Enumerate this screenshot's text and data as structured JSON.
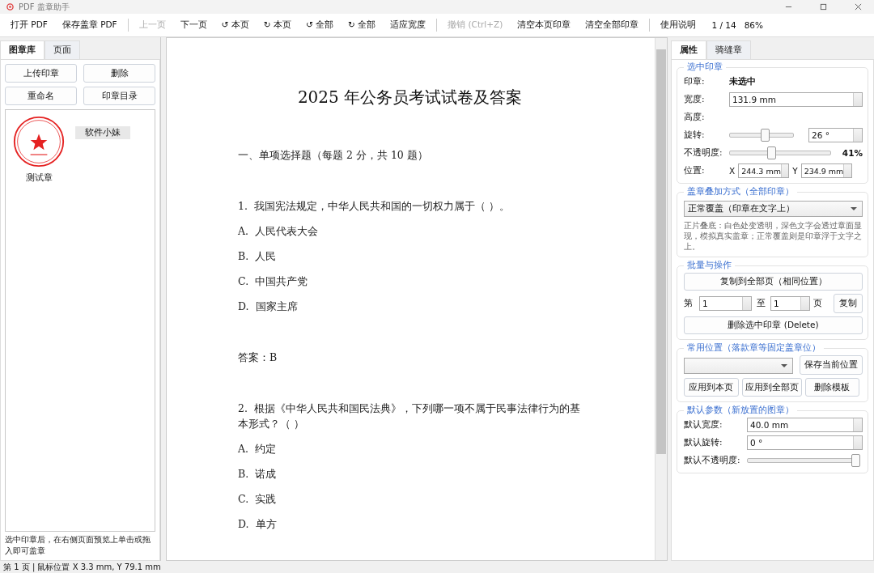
{
  "window": {
    "title": "PDF 盖章助手"
  },
  "toolbar": [
    {
      "kind": "button",
      "label": "打开 PDF",
      "disabled": false
    },
    {
      "kind": "button",
      "label": "保存盖章 PDF",
      "disabled": false
    },
    {
      "kind": "separator"
    },
    {
      "kind": "button",
      "label": "上一页",
      "disabled": true
    },
    {
      "kind": "button",
      "label": "下一页",
      "disabled": false
    },
    {
      "kind": "button",
      "label": "↺ 本页",
      "disabled": false
    },
    {
      "kind": "button",
      "label": "↻ 本页",
      "disabled": false
    },
    {
      "kind": "button",
      "label": "↺ 全部",
      "disabled": false
    },
    {
      "kind": "button",
      "label": "↻ 全部",
      "disabled": false
    },
    {
      "kind": "button",
      "label": "适应宽度",
      "disabled": false
    },
    {
      "kind": "separator"
    },
    {
      "kind": "button",
      "label": "撤销 (Ctrl+Z)",
      "disabled": true
    },
    {
      "kind": "button",
      "label": "清空本页印章",
      "disabled": false
    },
    {
      "kind": "button",
      "label": "清空全部印章",
      "disabled": false
    },
    {
      "kind": "separator"
    },
    {
      "kind": "button",
      "label": "使用说明",
      "disabled": false
    },
    {
      "kind": "text",
      "label": "1 / 14"
    },
    {
      "kind": "text",
      "label": "86%"
    }
  ],
  "left_panel": {
    "tabs": [
      {
        "label": "图章库",
        "selected": true
      },
      {
        "label": "页面",
        "selected": false
      }
    ],
    "buttons": [
      "上传印章",
      "删除",
      "重命名",
      "印章目录"
    ],
    "stamps": [
      {
        "kind": "seal",
        "label": "测试章",
        "selected": false
      },
      {
        "kind": "blank",
        "label": "软件小妹",
        "selected": true
      }
    ],
    "hint": "选中印章后，在右侧页面预览上单击或拖入即可盖章"
  },
  "document": {
    "title": "2025 年公务员考试试卷及答案",
    "lines": [
      {
        "kind": "section",
        "text": "一、单项选择题（每题 2 分，共 10 题）"
      },
      {
        "kind": "question",
        "text": "1.  我国宪法规定，中华人民共和国的一切权力属于（ ）。"
      },
      {
        "kind": "option",
        "text": "A.  人民代表大会"
      },
      {
        "kind": "option",
        "text": "B.  人民"
      },
      {
        "kind": "option",
        "text": "C.  中国共产党"
      },
      {
        "kind": "option",
        "text": "D.  国家主席"
      },
      {
        "kind": "answer",
        "text": "答案：B"
      },
      {
        "kind": "question",
        "text": "2.  根据《中华人民共和国民法典》，下列哪一项不属于民事法律行为的基本形式？（ ）"
      },
      {
        "kind": "option",
        "text": "A.  约定"
      },
      {
        "kind": "option",
        "text": "B.  诺成"
      },
      {
        "kind": "option",
        "text": "C.  实践"
      },
      {
        "kind": "option",
        "text": "D.  单方"
      }
    ]
  },
  "right_panel": {
    "tabs": [
      {
        "label": "属性",
        "selected": true
      },
      {
        "label": "骑缝章",
        "selected": false
      }
    ],
    "selected_stamp": {
      "title": "选中印章",
      "stamp_label": "印章:",
      "stamp_value": "未选中",
      "width_label": "宽度:",
      "width_value": "131.9 mm",
      "height_label": "高度:",
      "rotation_label": "旋转:",
      "rotation": {
        "level": 0.55
      },
      "rotation_value": "26 °",
      "opacity_label": "不透明度:",
      "opacity": {
        "level": 0.41
      },
      "opacity_value": "41%",
      "position_label": "位置:",
      "x_label": "X",
      "x_value": "244.3 mm",
      "y_label": "Y",
      "y_value": "234.9 mm"
    },
    "blend": {
      "title": "盖章叠加方式（全部印章）",
      "mode": "正常覆盖（印章在文字上）",
      "help": "正片叠底：白色处变透明，深色文字会透过章面显现，模拟真实盖章；正常覆盖则是印章浮于文字之上。"
    },
    "batch": {
      "title": "批量与操作",
      "copy_button": "复制到全部页（相同位置）",
      "from_label": "第",
      "from_value": "1",
      "to_label": "至",
      "to_value": "1",
      "page_label": "页",
      "copy_range_button": "复制",
      "delete_button": "删除选中印章 (Delete)"
    },
    "positions": {
      "title": "常用位置（落款章等固定盖章位）",
      "save_button": "保存当前位置",
      "apply_page_button": "应用到本页",
      "apply_all_button": "应用到全部页",
      "delete_button": "删除模板"
    },
    "defaults": {
      "title": "默认参数（新放置的图章）",
      "width_label": "默认宽度:",
      "width_value": "40.0 mm",
      "rotation_label": "默认旋转:",
      "rotation_value": "0 °",
      "opacity_label": "默认不透明度:",
      "opacity": {
        "level": 1
      }
    }
  },
  "status_bar": "第 1 页 | 鼠标位置 X 3.3 mm, Y 79.1 mm"
}
